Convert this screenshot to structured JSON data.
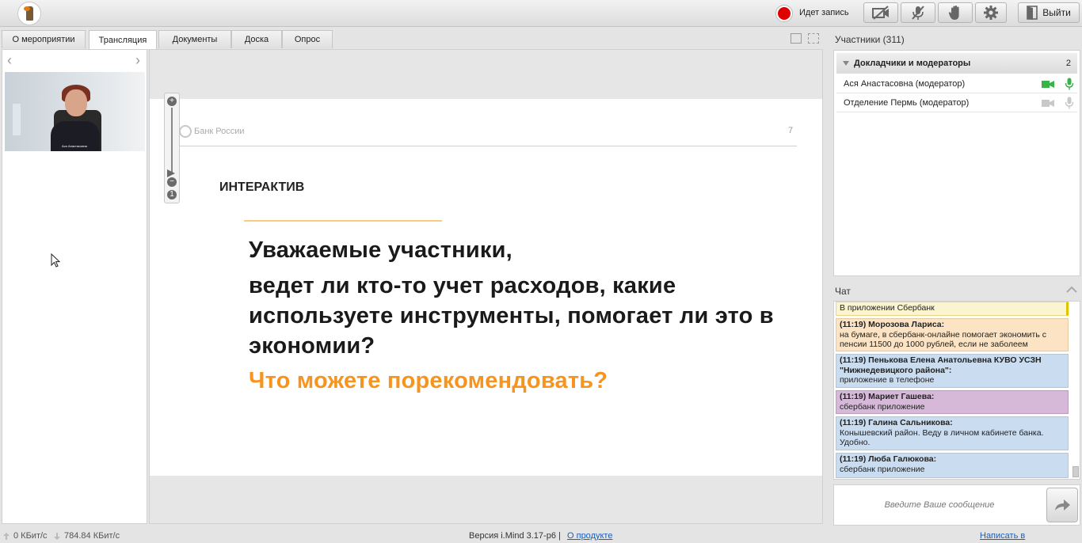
{
  "topbar": {
    "recording_label": "Идет запись",
    "exit_label": "Выйти",
    "logo_icon": "imind-logo-icon",
    "camera_off_icon": "camera-off-icon",
    "mic_off_icon": "mic-off-icon",
    "hand_icon": "raise-hand-icon",
    "settings_icon": "gear-icon",
    "exit_icon": "door-exit-icon"
  },
  "tabs": [
    {
      "label": "О мероприятии",
      "active": false
    },
    {
      "label": "Трансляция",
      "active": true
    },
    {
      "label": "Документы",
      "active": false
    },
    {
      "label": "Доска",
      "active": false
    },
    {
      "label": "Опрос",
      "active": false
    }
  ],
  "video": {
    "caption": "Ася Анастасовна"
  },
  "slide": {
    "brand": "Банк России",
    "page_number": "7",
    "tag": "ИНТЕРАКТИВ",
    "line1": "Уважаемые участники,",
    "line2": "ведет ли кто-то учет расходов, какие используете инструменты, помогает ли это в экономии?",
    "line3": "Что можете порекомендовать?",
    "zoom_in": "+",
    "zoom_out": "−",
    "zoom_reset": "1"
  },
  "participants": {
    "title": "Участники (311)",
    "group_name": "Докладчики и модераторы",
    "group_count": "2",
    "list": [
      {
        "name": "Ася Анастасовна (модератор)",
        "camera_active": true,
        "mic_active": true
      },
      {
        "name": "Отделение Пермь (модератор)",
        "camera_active": false,
        "mic_active": false
      }
    ]
  },
  "chat": {
    "title": "Чат",
    "messages": [
      {
        "meta": "",
        "text": "В приложении Сбербанк",
        "color": "#fbf5cf"
      },
      {
        "meta": "(11:19) Морозова Лариса:",
        "text": "на бумаге, в сбербанк-онлайне помогает экономить с пенсии 11500 до 1000 рублей, если не заболеем",
        "color": "#fbe3c3"
      },
      {
        "meta": "(11:19) Пенькова Елена Анатольевна КУВО УСЗН \"Нижнедевицкого района\":",
        "text": "приложение в телефоне",
        "color": "#c9dcf0"
      },
      {
        "meta": "(11:19) Мариет Гашева:",
        "text": "сбербанк приложение",
        "color": "#d6b8d8"
      },
      {
        "meta": "(11:19) Галина Сальникова:",
        "text": "Конышевский район. Веду в личном кабинете банка. Удобно.",
        "color": "#c9dcf0"
      },
      {
        "meta": "(11:19) Люба Галюкова:",
        "text": "сбербанк приложение",
        "color": "#c9dcf0"
      }
    ],
    "input_placeholder": "Введите Ваше сообщение"
  },
  "status": {
    "upload": "0 КБит/с",
    "download": "784.84 КБит/с",
    "version": "Версия i.Mind 3.17-p6",
    "separator": "|",
    "about_link": "О продукте",
    "support_link": "Написать в техподдержку"
  },
  "colors": {
    "accent_orange": "#f7941d",
    "record_red": "#e00000",
    "active_green": "#3ab24a",
    "link_blue": "#1d5fb4"
  }
}
